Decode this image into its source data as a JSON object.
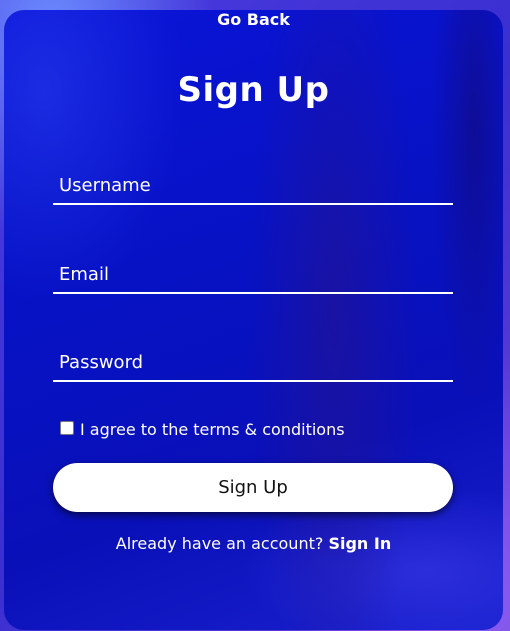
{
  "nav": {
    "go_back": "Go Back"
  },
  "form": {
    "title": "Sign Up",
    "username_placeholder": "Username",
    "email_placeholder": "Email",
    "password_placeholder": "Password",
    "terms_label": "I agree to the terms & conditions",
    "terms_checked": false,
    "submit_label": "Sign Up"
  },
  "footer": {
    "prompt": "Already have an account?",
    "signin_link": "Sign In"
  },
  "colors": {
    "card_background": "#0a14d8",
    "text": "#ffffff",
    "button_background": "#ffffff",
    "button_text": "#111111"
  }
}
